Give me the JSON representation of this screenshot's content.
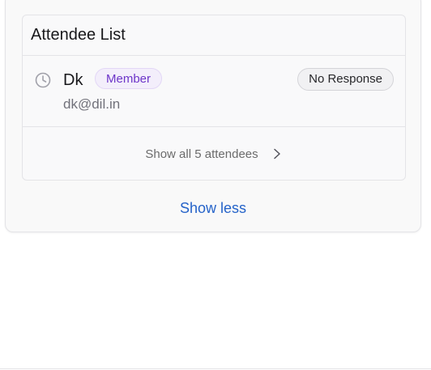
{
  "attendee_list": {
    "title": "Attendee List",
    "attendees": [
      {
        "name": "Dk",
        "role": "Member",
        "email": "dk@dil.in",
        "status": "No Response",
        "status_icon": "clock-icon"
      }
    ],
    "show_all_label": "Show all 5 attendees",
    "show_all_icon": "chevron-right-icon"
  },
  "show_less_label": "Show less",
  "colors": {
    "role_badge_text": "#6d35c9",
    "role_badge_bg": "#f3eefb",
    "link": "#2563c9"
  }
}
